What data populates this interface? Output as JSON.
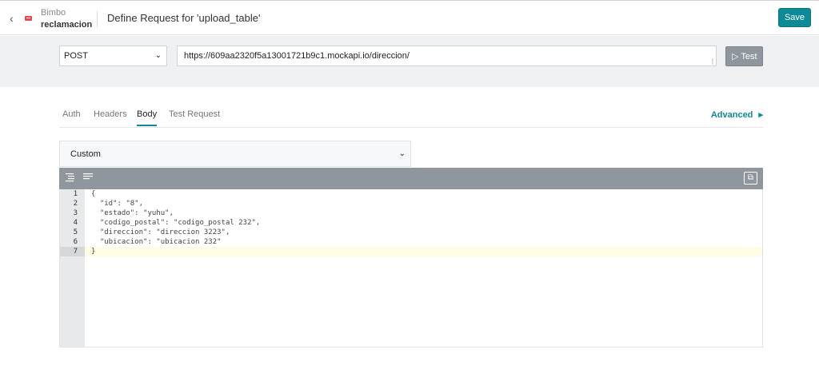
{
  "header": {
    "app_name": "Bimbo",
    "app_subtitle": "reclamacion",
    "page_title": "Define Request for 'upload_table'",
    "save_label": "Save"
  },
  "request": {
    "method": "POST",
    "url": "https://609aa2320f5a13001721b9c1.mockapi.io/direccion/",
    "test_label": "Test"
  },
  "tabs": [
    {
      "label": "Auth",
      "active": false
    },
    {
      "label": "Headers",
      "active": false
    },
    {
      "label": "Body",
      "active": true
    },
    {
      "label": "Test Request",
      "active": false
    }
  ],
  "advanced_label": "Advanced",
  "body_type": "Custom",
  "editor": {
    "lines": [
      {
        "number": "1",
        "text": "{"
      },
      {
        "number": "2",
        "text": "  \"id\": \"8\","
      },
      {
        "number": "3",
        "text": "  \"estado\": \"yuhu\","
      },
      {
        "number": "4",
        "text": "  \"codigo_postal\": \"codigo_postal 232\","
      },
      {
        "number": "5",
        "text": "  \"direccion\": \"direccion 3223\","
      },
      {
        "number": "6",
        "text": "  \"ubicacion\": \"ubicacion 232\""
      },
      {
        "number": "7",
        "text": "}"
      }
    ],
    "active_line": 7
  },
  "colors": {
    "accent": "#0e8a96",
    "toolbar": "#8f969d",
    "active_line": "#fefce2"
  },
  "icons": {
    "back": "chevron-left-icon",
    "test": "play-icon",
    "advanced": "caret-right-icon",
    "format": "align-format-icon",
    "menu": "lines-icon",
    "copy": "copy-icon"
  }
}
